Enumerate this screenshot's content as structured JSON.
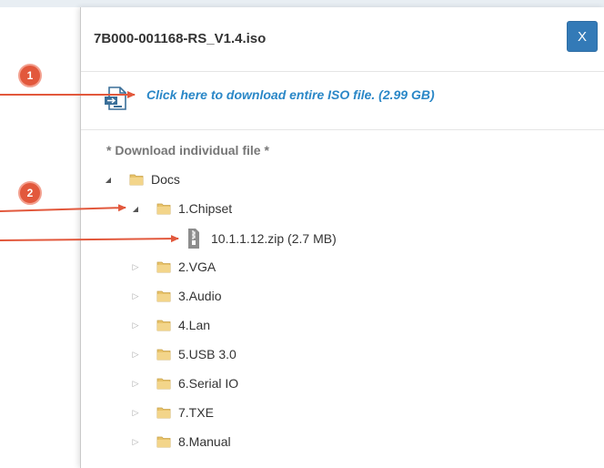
{
  "dialog": {
    "title": "7B000-001168-RS_V1.4.iso",
    "close_label": "X"
  },
  "download": {
    "link_text": "Click here to download entire ISO file. (2.99 GB)",
    "icon": "iso-download-icon"
  },
  "tree": {
    "heading": "* Download individual file *",
    "root": {
      "label": "Docs",
      "expanded": true
    },
    "children": [
      {
        "label": "1.Chipset",
        "expanded": true
      },
      {
        "label": "2.VGA",
        "expanded": false
      },
      {
        "label": "3.Audio",
        "expanded": false
      },
      {
        "label": "4.Lan",
        "expanded": false
      },
      {
        "label": "5.USB 3.0",
        "expanded": false
      },
      {
        "label": "6.Serial IO",
        "expanded": false
      },
      {
        "label": "7.TXE",
        "expanded": false
      },
      {
        "label": "8.Manual",
        "expanded": false
      }
    ],
    "file": {
      "label": "10.1.1.12.zip (2.7 MB)",
      "icon": "zip-file-icon"
    }
  },
  "callouts": {
    "first": "1",
    "second": "2"
  },
  "colors": {
    "accent": "#337ab7",
    "link": "#2a87c7",
    "callout": "#e2583c",
    "folder": "#e8c36a"
  }
}
